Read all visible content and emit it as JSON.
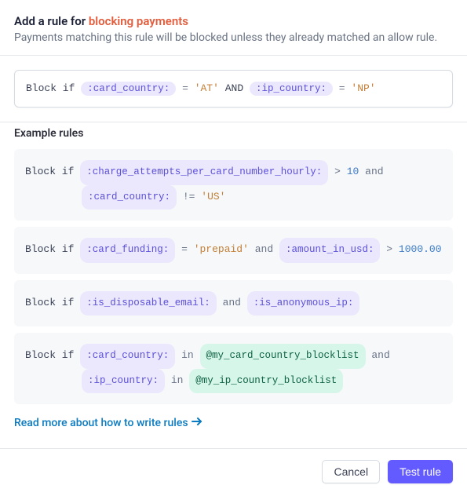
{
  "header": {
    "title_prefix": "Add a rule for ",
    "title_accent": "blocking payments",
    "subtitle": "Payments matching this rule will be blocked unless they already matched an allow rule."
  },
  "editor": {
    "keyword": "Block if",
    "tokens": {
      "field1": ":card_country:",
      "eq1": "=",
      "val1": "'AT'",
      "and": "AND",
      "field2": ":ip_country:",
      "eq2": "=",
      "val2": "'NP'"
    }
  },
  "examples": {
    "title": "Example rules",
    "e1": {
      "kw": "Block if",
      "f1": ":charge_attempts_per_card_number_hourly:",
      "op1": ">",
      "v1": "10",
      "and1": "and",
      "f2": ":card_country:",
      "op2": "!=",
      "v2": "'US'"
    },
    "e2": {
      "kw": "Block if",
      "f1": ":card_funding:",
      "op1": "=",
      "v1": "'prepaid'",
      "and1": "and",
      "f2": ":amount_in_usd:",
      "op2": ">",
      "v2": "1000.00"
    },
    "e3": {
      "kw": "Block if",
      "f1": ":is_disposable_email:",
      "and1": "and",
      "f2": ":is_anonymous_ip:"
    },
    "e4": {
      "kw": "Block if",
      "f1": ":card_country:",
      "in1": "in",
      "l1": "@my_card_country_blocklist",
      "and1": "and",
      "f2": ":ip_country:",
      "in2": "in",
      "l2": "@my_ip_country_blocklist"
    }
  },
  "readmore": "Read more about how to write rules",
  "footer": {
    "cancel": "Cancel",
    "test": "Test rule"
  }
}
